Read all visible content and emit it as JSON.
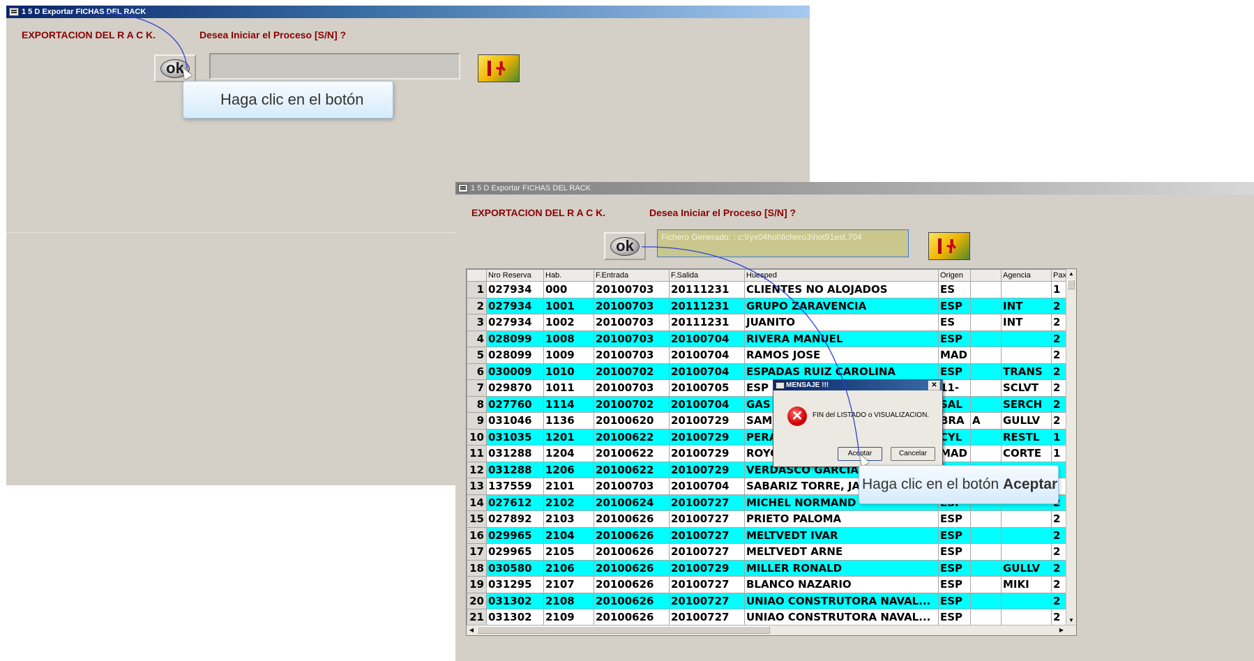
{
  "window1": {
    "title": "1 5 D Exportar FICHAS DEL RACK",
    "heading": "EXPORTACION DEL  R A C K.",
    "prompt": "Desea Iniciar el Proceso [S/N] ?",
    "ok_label": "ok",
    "input_value": ""
  },
  "callout1": {
    "text": "Haga clic en el botón"
  },
  "window2": {
    "title": "1 5 D Exportar FICHAS DEL RACK",
    "heading": "EXPORTACION DEL  R A C K.",
    "prompt": "Desea Iniciar el Proceso [S/N] ?",
    "ok_label": "ok",
    "input_value": "Fichero Generado: : c:\\ryx04hot\\fichero3\\hot91est.704"
  },
  "grid": {
    "columns": [
      "",
      "Nro Reserva",
      "Hab.",
      "F.Entrada",
      "F.Salida",
      "Huesped",
      "Origen",
      "",
      "Agencia",
      "Pax"
    ],
    "rows": [
      [
        "1",
        "027934",
        "000",
        "20100703",
        "20111231",
        "CLIENTES NO ALOJADOS",
        "ES",
        "",
        "",
        "1"
      ],
      [
        "2",
        "027934",
        "1001",
        "20100703",
        "20111231",
        "GRUPO ZARAVENCIA",
        "ESP",
        "",
        "INT",
        "2"
      ],
      [
        "3",
        "027934",
        "1002",
        "20100703",
        "20111231",
        "JUANITO",
        "ES",
        "",
        "INT",
        "2"
      ],
      [
        "4",
        "028099",
        "1008",
        "20100703",
        "20100704",
        "RIVERA MANUEL",
        "ESP",
        "",
        "",
        "2"
      ],
      [
        "5",
        "028099",
        "1009",
        "20100703",
        "20100704",
        "RAMOS JOSE",
        "MAD",
        "",
        "",
        "2"
      ],
      [
        "6",
        "030009",
        "1010",
        "20100702",
        "20100704",
        "ESPADAS RUIZ CAROLINA",
        "ESP",
        "",
        "TRANS",
        "2"
      ],
      [
        "7",
        "029870",
        "1011",
        "20100703",
        "20100705",
        "ESP I",
        "11-",
        "",
        "SCLVT",
        "2"
      ],
      [
        "8",
        "027760",
        "1114",
        "20100702",
        "20100704",
        "GAS",
        "SAL",
        "",
        "SERCH",
        "2"
      ],
      [
        "9",
        "031046",
        "1136",
        "20100620",
        "20100729",
        "SAMI",
        "BRA",
        "A",
        "GULLV",
        "2"
      ],
      [
        "10",
        "031035",
        "1201",
        "20100622",
        "20100729",
        "PERA",
        "CYL",
        "",
        "RESTL",
        "1"
      ],
      [
        "11",
        "031288",
        "1204",
        "20100622",
        "20100729",
        "ROYC",
        "MAD",
        "",
        "CORTE",
        "1"
      ],
      [
        "12",
        "031288",
        "1206",
        "20100622",
        "20100729",
        "VERDASCO GARCIA",
        "",
        "",
        "",
        ""
      ],
      [
        "13",
        "137559",
        "2101",
        "20100703",
        "20100704",
        "SABARIZ TORRE, JA",
        "",
        "",
        "",
        ""
      ],
      [
        "14",
        "027612",
        "2102",
        "20100624",
        "20100727",
        "MICHEL NORMAND",
        "ESP",
        "",
        "",
        "2"
      ],
      [
        "15",
        "027892",
        "2103",
        "20100626",
        "20100727",
        "PRIETO PALOMA",
        "ESP",
        "",
        "",
        "2"
      ],
      [
        "16",
        "029965",
        "2104",
        "20100626",
        "20100727",
        "MELTVEDT IVAR",
        "ESP",
        "",
        "",
        "2"
      ],
      [
        "17",
        "029965",
        "2105",
        "20100626",
        "20100727",
        "MELTVEDT ARNE",
        "ESP",
        "",
        "",
        "2"
      ],
      [
        "18",
        "030580",
        "2106",
        "20100626",
        "20100729",
        "MILLER RONALD",
        "ESP",
        "",
        "GULLV",
        "2"
      ],
      [
        "19",
        "031295",
        "2107",
        "20100626",
        "20100727",
        "BLANCO NAZARIO",
        "ESP",
        "",
        "MIKI",
        "2"
      ],
      [
        "20",
        "031302",
        "2108",
        "20100626",
        "20100727",
        "UNIAO CONSTRUTORA NAVAL...",
        "ESP",
        "",
        "",
        "2"
      ],
      [
        "21",
        "031302",
        "2109",
        "20100626",
        "20100727",
        "UNIAO CONSTRUTORA NAVAL...",
        "ESP",
        "",
        "",
        "2"
      ]
    ]
  },
  "dialog": {
    "title": "MENSAJE !!!",
    "close_label": "✕",
    "message": "FIN del LISTADO o VISUALIZACION.",
    "accept_label": "Aceptar",
    "cancel_label": "Cancelar"
  },
  "callout2": {
    "prefix": "Haga clic en el botón ",
    "bold": "Aceptar"
  },
  "colors": {
    "row_highlight": "#00ffff",
    "label_red": "#8b0000",
    "window_bg": "#d4d0c8"
  },
  "icons": [
    "app-window-icon",
    "exit-door-icon",
    "error-icon",
    "close-icon",
    "mouse-cursor-icon"
  ]
}
